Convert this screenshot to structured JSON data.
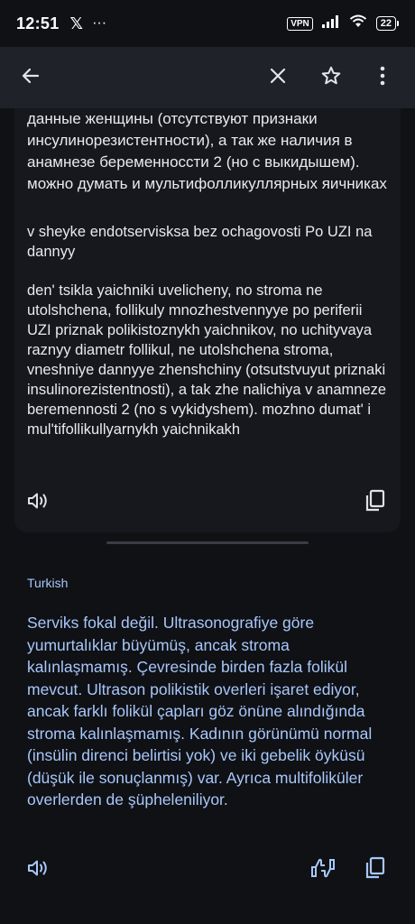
{
  "status_bar": {
    "time": "12:51",
    "x_logo": "𝕏",
    "more": "···",
    "vpn": "VPN",
    "battery": "22"
  },
  "app_bar": {
    "back_icon": "arrow-left-icon",
    "close_icon": "close-icon",
    "star_icon": "star-outline-icon",
    "menu_icon": "more-vertical-icon"
  },
  "source_block": {
    "cyrillic_text": "данные женщины (отсутствуют признаки инсулинорезистентности), а так же наличия в анамнезе беременноссти 2 (но с выкидышем). можно думать и мультифолликуллярных яичниках",
    "transliteration_1": "v sheyke endotservisksa bez ochagovosti Po UZI na dannyy",
    "transliteration_2": "den' tsikla yaichniki uvelicheny, no stroma ne utolshchena, follikuly mnozhestvennyye po periferii UZI priznak polikistoznykh yaichnikov, no uchityvaya raznyy diametr follikul, ne utolshchena stroma, vneshniye dannyye zhenshchiny (otsutstvuyut priznaki insulinorezistentnosti), a tak zhe nalichiya v anamneze beremennosti 2 (no s vykidyshem). mozhno dumat' i mul'tifollikullyarnykh yaichnikakh"
  },
  "target_block": {
    "language": "Turkish",
    "text": "Serviks fokal değil. Ultrasonografiye göre yumurtalıklar büyümüş, ancak stroma kalınlaşmamış. Çevresinde birden fazla folikül mevcut. Ultrason polikistik overleri işaret ediyor, ancak farklı folikül çapları göz önüne alındığında stroma kalınlaşmamış. Kadının görünümü normal (insülin direnci belirtisi yok) ve iki gebelik öyküsü (düşük ile sonuçlanmış) var. Ayrıca multifoliküler overlerden de şüpheleniliyor."
  },
  "icons": {
    "speaker": "speaker-icon",
    "copy": "copy-icon",
    "feedback": "feedback-icon"
  }
}
